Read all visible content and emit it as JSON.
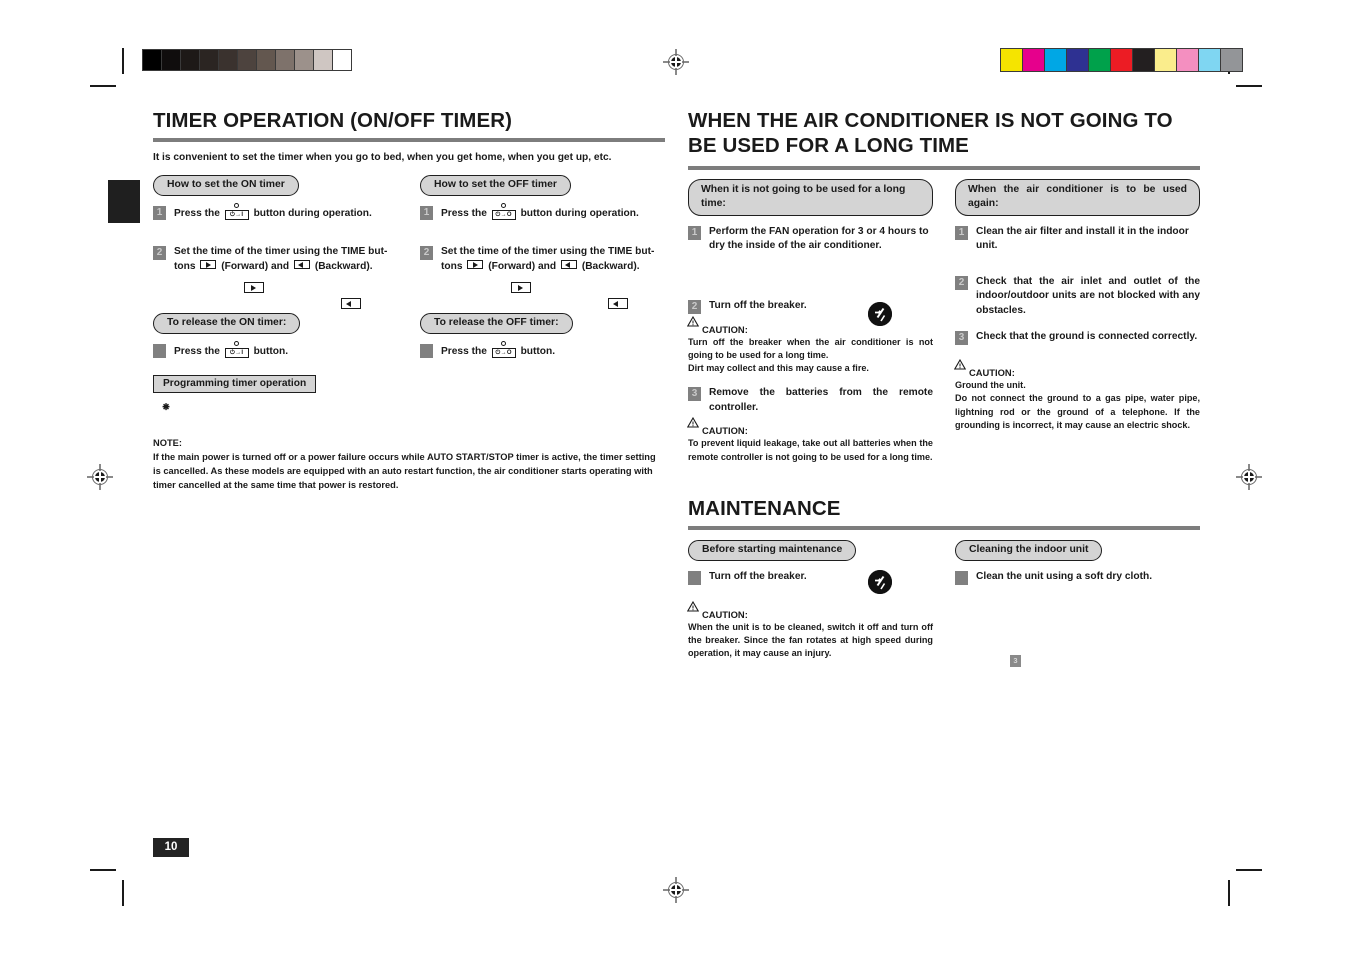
{
  "document": {
    "page_number": "10",
    "small_marker_number": "3"
  },
  "print_marks": {
    "grayscale_bar": [
      "#000000",
      "#100d0d",
      "#1d1917",
      "#2b2522",
      "#3a322e",
      "#4d433e",
      "#63574f",
      "#7e726b",
      "#9c918b",
      "#cfc6c2",
      "#ffffff"
    ],
    "color_bar": [
      "#f5e400",
      "#e6008c",
      "#00a7e5",
      "#2e3192",
      "#00a14b",
      "#ec1c24",
      "#231f20",
      "#faed8c",
      "#f48fc0",
      "#7fd6f2",
      "#939598"
    ]
  },
  "left_column": {
    "title": "TIMER OPERATION (ON/OFF TIMER)",
    "lead": "It is convenient to set the timer when you go to bed, when you get home, when you get up, etc.",
    "on_timer": {
      "heading": "How to set the ON timer",
      "step1_num": "1",
      "step1_a": "Press the",
      "step1_icon_label": "⏻→I",
      "step1_b": "button during operation.",
      "step2_num": "2",
      "step2_a": "Set the time of the timer using the TIME but-",
      "step2_b": "tons",
      "step2_c": "(Forward) and",
      "step2_d": "(Backward).",
      "release_heading": "To release the ON timer:",
      "release_a": "Press the",
      "release_b": "button."
    },
    "off_timer": {
      "heading": "How to set the OFF timer",
      "step1_num": "1",
      "step1_a": "Press the",
      "step1_icon_label": "⏻→O",
      "step1_b": "button during operation.",
      "step2_num": "2",
      "step2_a": "Set the time of the timer using the TIME but-",
      "step2_b": "tons",
      "step2_c": "(Forward) and",
      "step2_d": "(Backward).",
      "release_heading": "To release the OFF timer:",
      "release_a": "Press the",
      "release_b": "button."
    },
    "programming_box": "Programming timer operation",
    "note_label": "NOTE:",
    "note_text": "If the main power is turned off or a power failure occurs while AUTO START/STOP timer is active, the timer setting is cancelled. As these models are equipped with an auto restart function, the air conditioner starts operating with timer cancelled at the same time that power is restored."
  },
  "right_column": {
    "title": "WHEN THE AIR CONDITIONER IS NOT GOING TO BE USED FOR A LONG TIME",
    "not_used": {
      "heading": "When it is not going to be used for a long time:",
      "step1_num": "1",
      "step1_text": "Perform the FAN operation for 3 or 4 hours to dry the inside of the air conditioner.",
      "step2_num": "2",
      "step2_text": "Turn off the breaker.",
      "caution1_label": "CAUTION:",
      "caution1_text": "Turn off the breaker when the air conditioner is not going to be used for a long time.\nDirt may collect and this may cause a fire.",
      "step3_num": "3",
      "step3_text": "Remove the batteries from the remote controller.",
      "caution2_label": "CAUTION:",
      "caution2_text": "To prevent liquid leakage, take out all batteries when the remote controller is not going to be used for a long time."
    },
    "used_again": {
      "heading": "When the air conditioner is to be used again:",
      "step1_num": "1",
      "step1_text": "Clean the air filter and install it in the indoor unit.",
      "step2_num": "2",
      "step2_text": "Check that the air inlet and outlet of the indoor/outdoor units are not blocked with any obstacles.",
      "step3_num": "3",
      "step3_text": "Check that the ground is connected correctly.",
      "caution_label": "CAUTION:",
      "caution_text": "Ground the unit.\nDo not connect the ground to a gas pipe, water pipe, lightning rod or the ground of a telephone. If the grounding is incorrect, it may cause an electric shock."
    },
    "maintenance": {
      "title": "MAINTENANCE",
      "before": {
        "heading": "Before starting maintenance",
        "step_text": "Turn off the breaker.",
        "caution_label": "CAUTION:",
        "caution_text": "When the unit is to be cleaned, switch it off and turn off the breaker. Since the fan rotates at high speed during operation, it may cause an injury."
      },
      "cleaning": {
        "heading": "Cleaning the indoor unit",
        "step_text": "Clean the unit using a soft dry cloth."
      }
    }
  }
}
